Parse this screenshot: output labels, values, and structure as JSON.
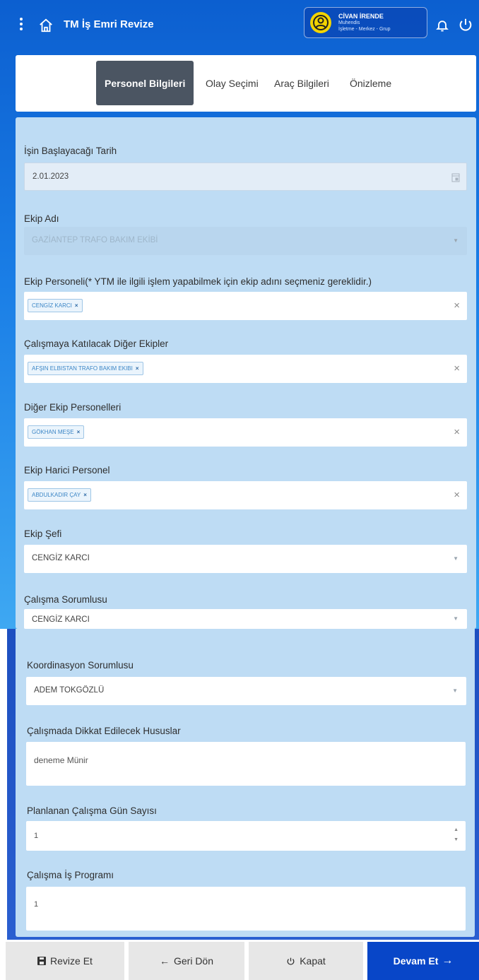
{
  "header": {
    "title": "TM İş Emri Revize",
    "user_name": "CİVAN İRENDE",
    "user_role": "Muhendis",
    "user_org": "İşletme - Merkez - Grup"
  },
  "tabs": [
    {
      "label": "Personel Bilgileri",
      "active": true
    },
    {
      "label": "Olay Seçimi",
      "active": false
    },
    {
      "label": "Araç Bilgileri",
      "active": false
    },
    {
      "label": "Önizleme",
      "active": false
    }
  ],
  "form": {
    "start_date": {
      "label": "İşin Başlayacağı Tarih",
      "value": "2.01.2023"
    },
    "team_name": {
      "label": "Ekip Adı",
      "value": "GAZİANTEP TRAFO BAKIM EKİBİ"
    },
    "team_staff": {
      "label": "Ekip Personeli(* YTM ile ilgili işlem yapabilmek için ekip adını seçmeniz gereklidir.)",
      "tag": "CENGİZ KARCI"
    },
    "other_teams": {
      "label": "Çalışmaya Katılacak Diğer Ekipler",
      "tag": "AFŞIN ELBISTAN TRAFO BAKIM EKIBI"
    },
    "other_team_staff": {
      "label": "Diğer Ekip Personelleri",
      "tag": "GÖKHAN MEŞE"
    },
    "external_staff": {
      "label": "Ekip Harici Personel",
      "tag": "ABDULKADIR ÇAY"
    },
    "team_chief": {
      "label": "Ekip Şefi",
      "value": "CENGİZ KARCI"
    },
    "work_responsible": {
      "label": "Çalışma Sorumlusu",
      "value": "CENGİZ KARCI"
    },
    "coordination_responsible": {
      "label": "Koordinasyon Sorumlusu",
      "value": "ADEM TOKGÖZLÜ"
    },
    "notes": {
      "label": "Çalışmada Dikkat Edilecek Hususlar",
      "value": "deneme Münir"
    },
    "planned_days": {
      "label": "Planlanan Çalışma Gün Sayısı",
      "value": "1"
    },
    "work_program": {
      "label": "Çalışma İş Programı",
      "value": "1"
    }
  },
  "buttons": {
    "revise": "Revize Et",
    "back": "Geri Dön",
    "close": "Kapat",
    "continue": "Devam Et"
  },
  "colors": {
    "header_blue": "#0c5fd0",
    "form_bg": "#bedcf4",
    "active_tab": "#4b5562",
    "primary_button": "#0846c8",
    "avatar_yellow": "#f3d400"
  },
  "icons": [
    "kebab-menu-icon",
    "home-icon",
    "user-avatar-icon",
    "bell-icon",
    "power-icon",
    "calendar-icon",
    "save-icon",
    "arrow-left-icon",
    "power-off-icon",
    "arrow-right-icon"
  ]
}
